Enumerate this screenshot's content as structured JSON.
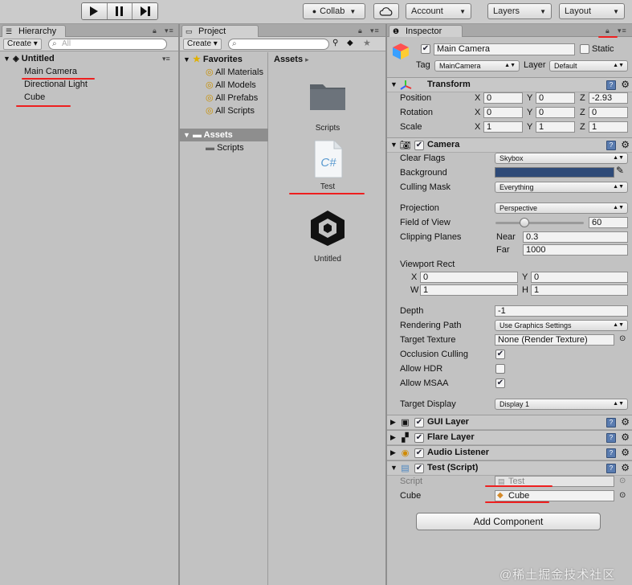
{
  "toolbar": {
    "collab": "Collab",
    "account": "Account",
    "layers": "Layers",
    "layout": "Layout"
  },
  "hierarchy": {
    "tab": "Hierarchy",
    "create": "Create",
    "search_placeholder": "All",
    "scene": "Untitled",
    "items": [
      "Main Camera",
      "Directional Light",
      "Cube"
    ]
  },
  "project": {
    "tab": "Project",
    "create": "Create",
    "favorites": "Favorites",
    "fav_items": [
      "All Materials",
      "All Models",
      "All Prefabs",
      "All Scripts"
    ],
    "assets": "Assets",
    "asset_children": [
      "Scripts"
    ],
    "breadcrumb": "Assets",
    "grid": [
      "Scripts",
      "Test",
      "Untitled"
    ],
    "cs_glyph": "C#"
  },
  "inspector": {
    "tab": "Inspector",
    "object_name": "Main Camera",
    "static": "Static",
    "tag_label": "Tag",
    "tag_value": "MainCamera",
    "layer_label": "Layer",
    "layer_value": "Default",
    "transform": {
      "title": "Transform",
      "position_label": "Position",
      "rotation_label": "Rotation",
      "scale_label": "Scale",
      "x": "X",
      "y": "Y",
      "z": "Z",
      "position": [
        "0",
        "0",
        "-2.93"
      ],
      "rotation": [
        "0",
        "0",
        "0"
      ],
      "scale": [
        "1",
        "1",
        "1"
      ]
    },
    "camera": {
      "title": "Camera",
      "clear_flags_label": "Clear Flags",
      "clear_flags": "Skybox",
      "background_label": "Background",
      "background_color": "#2e4a78",
      "culling_mask_label": "Culling Mask",
      "culling_mask": "Everything",
      "projection_label": "Projection",
      "projection": "Perspective",
      "fov_label": "Field of View",
      "fov": "60",
      "fov_fraction": 0.33,
      "clipping_label": "Clipping Planes",
      "near_label": "Near",
      "near": "0.3",
      "far_label": "Far",
      "far": "1000",
      "viewport_label": "Viewport Rect",
      "vx_label": "X",
      "vx": "0",
      "vy_label": "Y",
      "vy": "0",
      "vw_label": "W",
      "vw": "1",
      "vh_label": "H",
      "vh": "1",
      "depth_label": "Depth",
      "depth": "-1",
      "render_path_label": "Rendering Path",
      "render_path": "Use Graphics Settings",
      "target_texture_label": "Target Texture",
      "target_texture": "None (Render Texture)",
      "occlusion_label": "Occlusion Culling",
      "hdr_label": "Allow HDR",
      "msaa_label": "Allow MSAA",
      "target_display_label": "Target Display",
      "target_display": "Display 1"
    },
    "components": [
      "GUI Layer",
      "Flare Layer",
      "Audio Listener"
    ],
    "test_script": {
      "title": "Test (Script)",
      "script_label": "Script",
      "script_value": "Test",
      "cube_label": "Cube",
      "cube_value": "Cube"
    },
    "add_component": "Add Component"
  },
  "watermark": "@稀土掘金技术社区"
}
